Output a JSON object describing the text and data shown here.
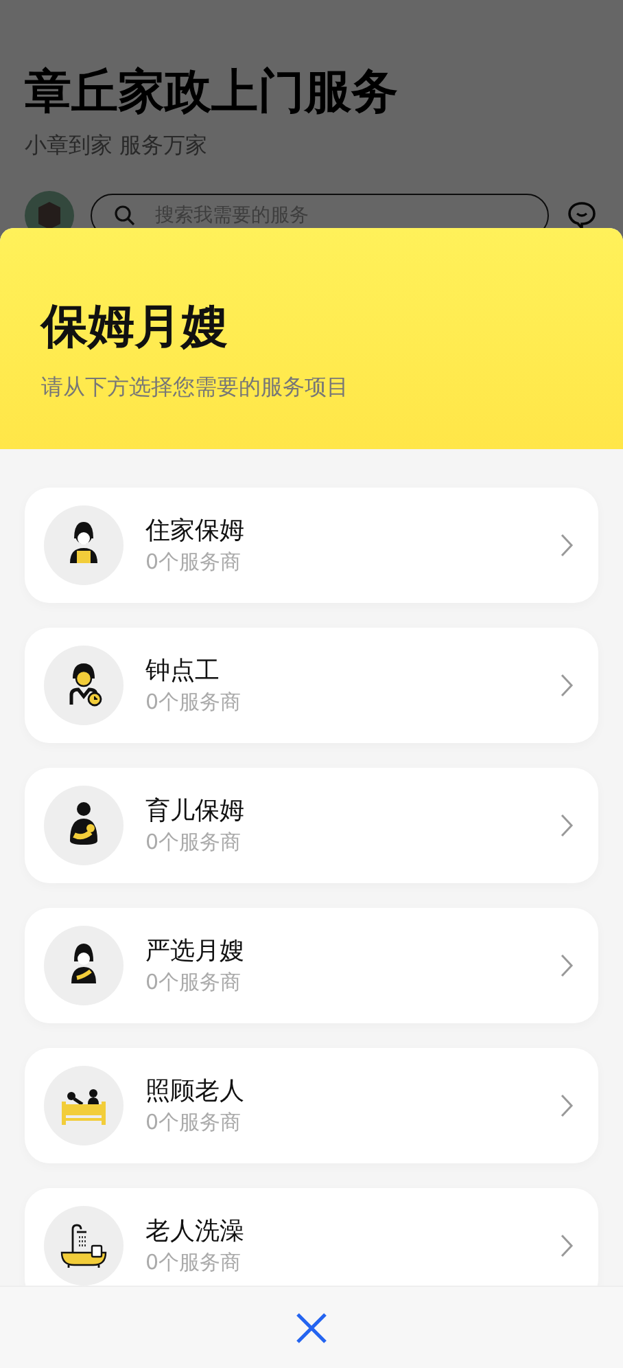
{
  "page": {
    "title": "章丘家政上门服务",
    "subtitle": "小章到家 服务万家",
    "search": {
      "placeholder": "搜索我需要的服务"
    }
  },
  "sheet": {
    "title": "保姆月嫂",
    "subtitle": "请从下方选择您需要的服务项目",
    "services": [
      {
        "kind": "nanny",
        "name": "住家保姆",
        "count": "0个服务商"
      },
      {
        "kind": "hourly",
        "name": "钟点工",
        "count": "0个服务商"
      },
      {
        "kind": "childcare",
        "name": "育儿保姆",
        "count": "0个服务商"
      },
      {
        "kind": "maternity",
        "name": "严选月嫂",
        "count": "0个服务商"
      },
      {
        "kind": "elderly",
        "name": "照顾老人",
        "count": "0个服务商"
      },
      {
        "kind": "bathing",
        "name": "老人洗澡",
        "count": "0个服务商"
      }
    ]
  }
}
